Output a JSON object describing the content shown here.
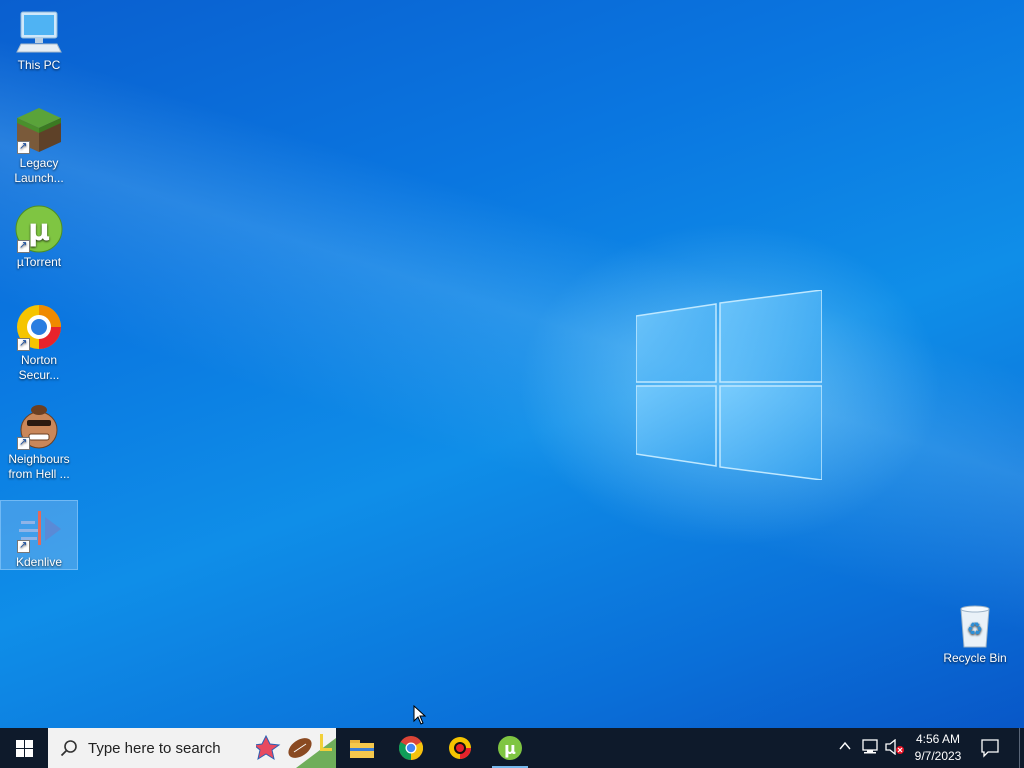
{
  "desktop": {
    "icons": [
      {
        "name": "This PC",
        "shortcut": false
      },
      {
        "name": "Legacy Launch...",
        "shortcut": true
      },
      {
        "name": "µTorrent",
        "shortcut": true
      },
      {
        "name": "Norton Secur...",
        "shortcut": true
      },
      {
        "name": "Neighbours from Hell ...",
        "shortcut": true
      },
      {
        "name": "Kdenlive",
        "shortcut": true,
        "selected": true
      },
      {
        "name": "Recycle Bin",
        "shortcut": false
      }
    ]
  },
  "taskbar": {
    "search_placeholder": "Type here to search",
    "pinned": [
      "file-explorer-icon",
      "chrome-icon",
      "norton-icon",
      "utorrent-icon"
    ],
    "active_app": "utorrent-icon",
    "clock": {
      "time": "4:56 AM",
      "date": "9/7/2023"
    }
  },
  "colors": {
    "desktop_blue": "#0a76e0",
    "taskbar": "#0e1a2b",
    "accent": "#76b9ed"
  }
}
